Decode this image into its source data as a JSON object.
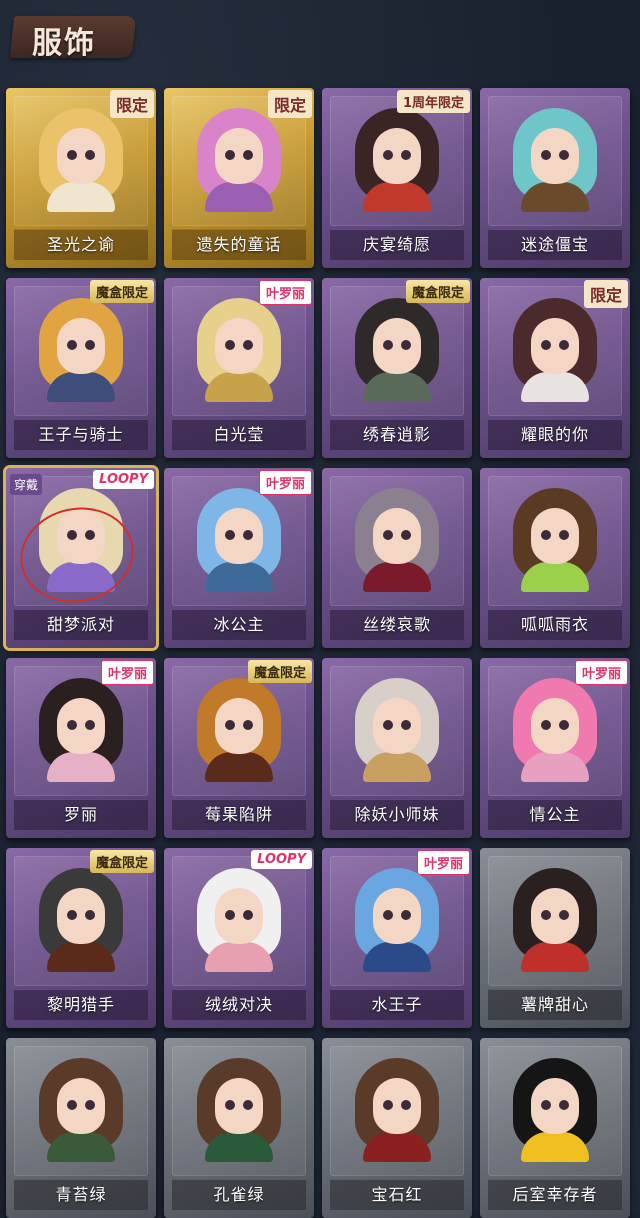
{
  "header": {
    "title": "服饰"
  },
  "cards": [
    {
      "name": "圣光之谕",
      "style": "gold",
      "badge": "限定",
      "badge_type": "limited",
      "hair": "#e9c26a",
      "outfit": "#f0e6d0"
    },
    {
      "name": "遗失的童话",
      "style": "gold",
      "badge": "限定",
      "badge_type": "limited",
      "hair": "#d983c9",
      "outfit": "#9a5fb0"
    },
    {
      "name": "庆宴绮愿",
      "style": "purple",
      "badge": "1周年限定",
      "badge_type": "anniv",
      "hair": "#3a2424",
      "outfit": "#c0392b"
    },
    {
      "name": "迷途僵宝",
      "style": "purple",
      "badge": "",
      "badge_type": "",
      "hair": "#6fc6c9",
      "outfit": "#6a4a2a"
    },
    {
      "name": "王子与骑士",
      "style": "purple",
      "badge": "魔盒限定",
      "badge_type": "box",
      "hair": "#e0a442",
      "outfit": "#3e4d7a"
    },
    {
      "name": "白光莹",
      "style": "purple",
      "badge": "叶罗丽",
      "badge_type": "lolita",
      "hair": "#e6d08c",
      "outfit": "#c7a24a"
    },
    {
      "name": "绣春逍影",
      "style": "purple",
      "badge": "魔盒限定",
      "badge_type": "box",
      "hair": "#2e2a2a",
      "outfit": "#5a6a5a"
    },
    {
      "name": "耀眼的你",
      "style": "purple",
      "badge": "限定",
      "badge_type": "limited",
      "hair": "#4a2a2a",
      "outfit": "#e8e2e0"
    },
    {
      "name": "甜梦派对",
      "style": "purple",
      "badge": "LOOPY",
      "badge_type": "loopy",
      "hair": "#e8d8b0",
      "outfit": "#8a6ac8",
      "selected": true,
      "wear": "穿戴"
    },
    {
      "name": "冰公主",
      "style": "purple",
      "badge": "叶罗丽",
      "badge_type": "lolita",
      "hair": "#7fb6e8",
      "outfit": "#3e6a9a"
    },
    {
      "name": "丝缕哀歌",
      "style": "purple",
      "badge": "",
      "badge_type": "",
      "hair": "#8a8090",
      "outfit": "#7a1a2a"
    },
    {
      "name": "呱呱雨衣",
      "style": "purple",
      "badge": "",
      "badge_type": "",
      "hair": "#5a3a22",
      "outfit": "#9ad04a"
    },
    {
      "name": "罗丽",
      "style": "purple",
      "badge": "叶罗丽",
      "badge_type": "lolita",
      "hair": "#2a2020",
      "outfit": "#e6b0c6"
    },
    {
      "name": "莓果陷阱",
      "style": "purple",
      "badge": "魔盒限定",
      "badge_type": "box",
      "hair": "#c07a2a",
      "outfit": "#5a2a1a"
    },
    {
      "name": "除妖小师妹",
      "style": "purple",
      "badge": "",
      "badge_type": "",
      "hair": "#d8d0c8",
      "outfit": "#c8a060"
    },
    {
      "name": "情公主",
      "style": "purple",
      "badge": "叶罗丽",
      "badge_type": "lolita",
      "hair": "#f07ab0",
      "outfit": "#e8a0c0"
    },
    {
      "name": "黎明猎手",
      "style": "purple",
      "badge": "魔盒限定",
      "badge_type": "box",
      "hair": "#3a3a3a",
      "outfit": "#5a2a1a"
    },
    {
      "name": "绒绒对决",
      "style": "purple",
      "badge": "LOOPY",
      "badge_type": "loopy",
      "hair": "#f0f0f0",
      "outfit": "#e8a0b0"
    },
    {
      "name": "水王子",
      "style": "purple",
      "badge": "叶罗丽",
      "badge_type": "lolita",
      "hair": "#6aa6e0",
      "outfit": "#2a4a8a"
    },
    {
      "name": "薯牌甜心",
      "style": "gray",
      "badge": "",
      "badge_type": "",
      "hair": "#2a2020",
      "outfit": "#c0302a"
    },
    {
      "name": "青苔绿",
      "style": "gray",
      "badge": "",
      "badge_type": "",
      "hair": "#5a3a28",
      "outfit": "#3a5a3a"
    },
    {
      "name": "孔雀绿",
      "style": "gray",
      "badge": "",
      "badge_type": "",
      "hair": "#5a3a28",
      "outfit": "#2a5a3a"
    },
    {
      "name": "宝石红",
      "style": "gray",
      "badge": "",
      "badge_type": "",
      "hair": "#5a3a28",
      "outfit": "#8a2020"
    },
    {
      "name": "后室幸存者",
      "style": "gray",
      "badge": "",
      "badge_type": "",
      "hair": "#151515",
      "outfit": "#f0c020"
    }
  ]
}
